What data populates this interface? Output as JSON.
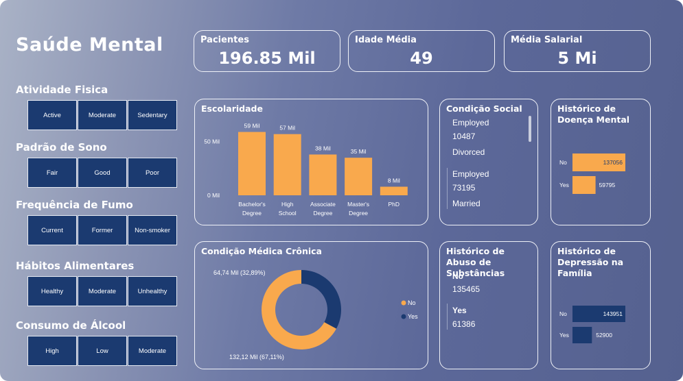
{
  "title": "Saúde Mental",
  "filters": [
    {
      "label": "Atividade Fisica",
      "options": [
        "Active",
        "Moderate",
        "Sedentary"
      ]
    },
    {
      "label": "Padrão de Sono",
      "options": [
        "Fair",
        "Good",
        "Poor"
      ]
    },
    {
      "label": "Frequência de Fumo",
      "options": [
        "Current",
        "Former",
        "Non-smoker"
      ]
    },
    {
      "label": "Hábitos Alimentares",
      "options": [
        "Healthy",
        "Moderate",
        "Unhealthy"
      ]
    },
    {
      "label": "Consumo de Álcool",
      "options": [
        "High",
        "Low",
        "Moderate"
      ]
    }
  ],
  "kpis": [
    {
      "label": "Pacientes",
      "value": "196.85 Mil"
    },
    {
      "label": "Idade Média",
      "value": "49"
    },
    {
      "label": "Média Salarial",
      "value": "5 Mi"
    }
  ],
  "condicao_social": {
    "title": "Condição Social",
    "lines": [
      "Employed",
      "10487",
      "Divorced",
      "Employed",
      "73195",
      "Married"
    ]
  },
  "abuso": {
    "title": "Histórico de Abuso de Substâncias",
    "lines": [
      "No",
      "135465",
      "Yes",
      "61386"
    ]
  },
  "colors": {
    "orange": "#f9a94d",
    "navy": "#1b3a70",
    "border": "#f0f2f8"
  },
  "chart_data": [
    {
      "type": "bar",
      "title": "Escolaridade",
      "categories": [
        "Bachelor's Degree",
        "High School",
        "Associate Degree",
        "Master's Degree",
        "PhD"
      ],
      "category_lines": [
        [
          "Bachelor's",
          "Degree"
        ],
        [
          "High",
          "School"
        ],
        [
          "Associate",
          "Degree"
        ],
        [
          "Master's",
          "Degree"
        ],
        [
          "PhD"
        ]
      ],
      "values": [
        59000,
        57000,
        38000,
        35000,
        8000
      ],
      "data_labels": [
        "59 Mil",
        "57 Mil",
        "38 Mil",
        "35 Mil",
        "8 Mil"
      ],
      "yticks": [
        {
          "value": 0,
          "label": "0 Mil"
        },
        {
          "value": 50000,
          "label": "50 Mil"
        }
      ],
      "ylim": [
        0,
        60000
      ],
      "color": "#f9a94d"
    },
    {
      "type": "bar",
      "orientation": "horizontal",
      "title": "Histórico de Doença Mental",
      "categories": [
        "No",
        "Yes"
      ],
      "values": [
        137056,
        59795
      ],
      "data_labels": [
        "137056",
        "59795"
      ],
      "xlim": [
        0,
        137056
      ],
      "color": "#f9a94d"
    },
    {
      "type": "pie",
      "donut": true,
      "title": "Condição Médica Crônica",
      "slices": [
        {
          "name": "No",
          "value": 132.12,
          "label": "132,12 Mil (67,11%)",
          "color": "#f9a94d"
        },
        {
          "name": "Yes",
          "value": 64.74,
          "label": "64,74 Mil (32,89%)",
          "color": "#1b3a70"
        }
      ],
      "legend": "right"
    },
    {
      "type": "bar",
      "orientation": "horizontal",
      "title": "Histórico de Depressão na Família",
      "categories": [
        "No",
        "Yes"
      ],
      "values": [
        143951,
        52900
      ],
      "data_labels": [
        "143951",
        "52900"
      ],
      "xlim": [
        0,
        143951
      ],
      "color": "#1b3a70"
    }
  ]
}
